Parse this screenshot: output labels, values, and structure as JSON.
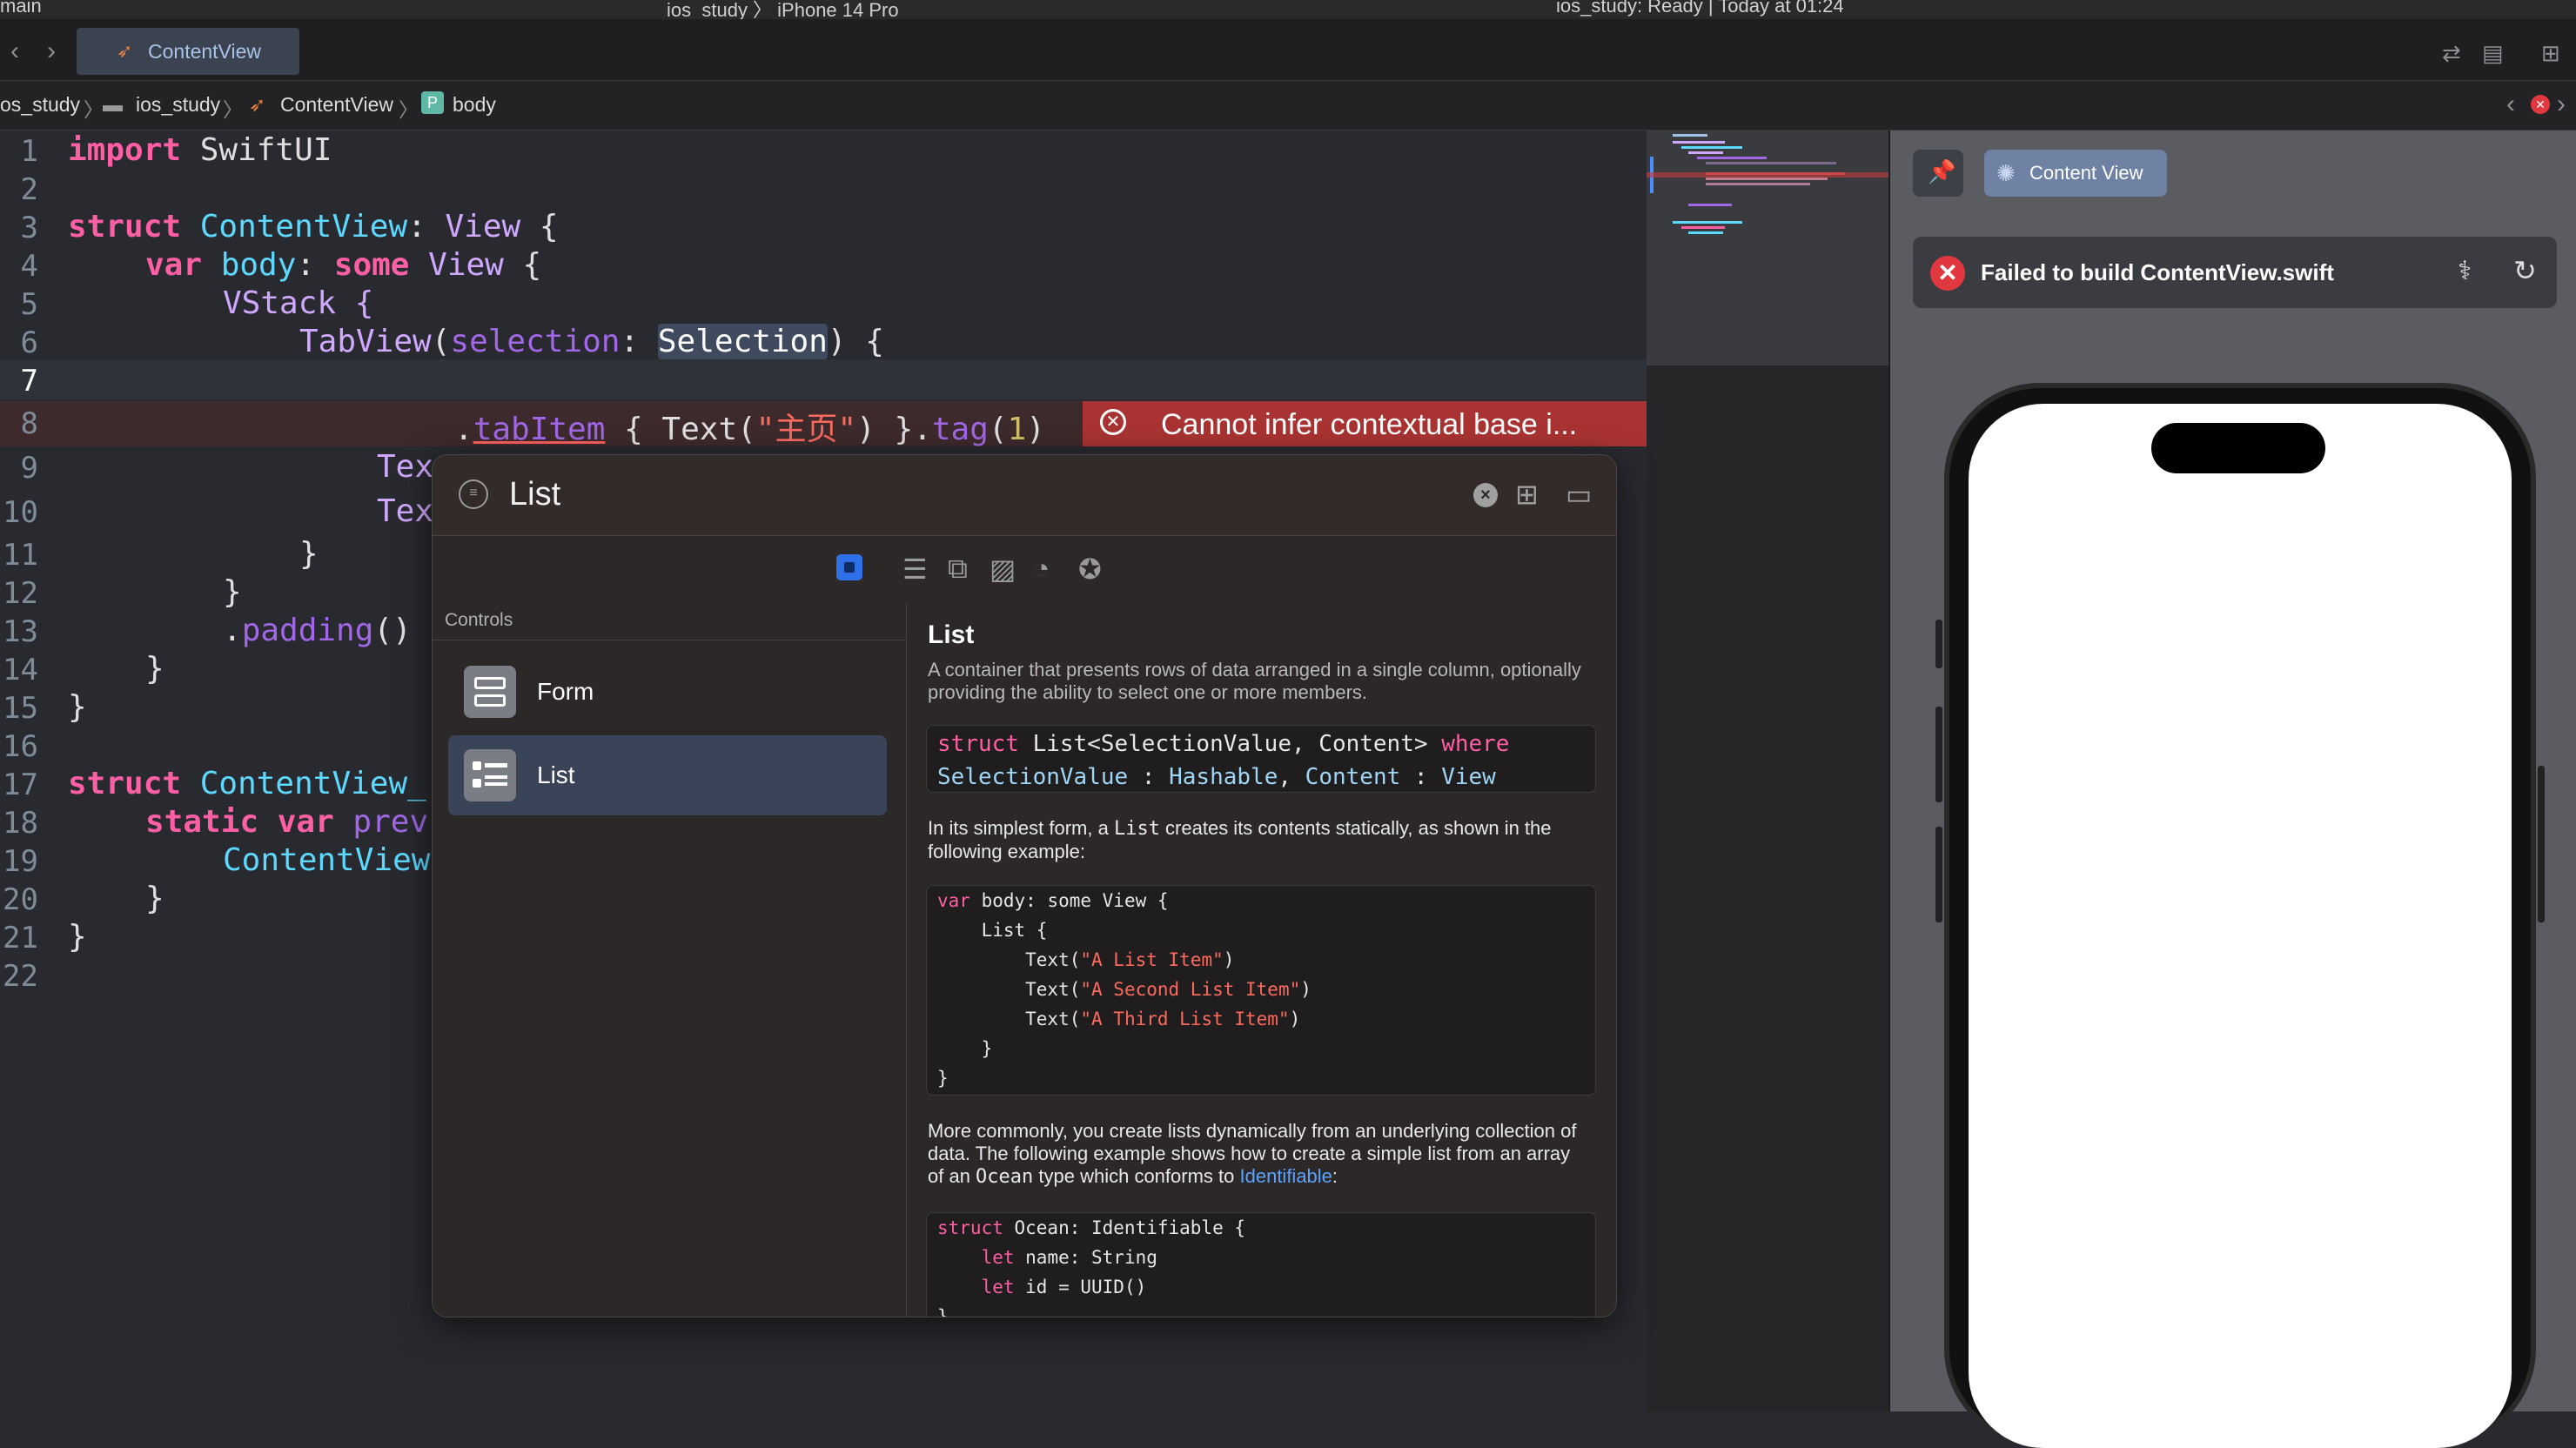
{
  "top": {
    "left_text": "main",
    "device": "ios_study 〉 iPhone 14 Pro",
    "status": "ios_study: Ready | Today at 01:24"
  },
  "tab": {
    "label": "ContentView"
  },
  "breadcrumb": {
    "items": [
      "os_study",
      "ios_study",
      "ContentView",
      "body"
    ],
    "p_badge": "P"
  },
  "editor": {
    "lines": [
      {
        "n": "1"
      },
      {
        "n": "2"
      },
      {
        "n": "3"
      },
      {
        "n": "4"
      },
      {
        "n": "5"
      },
      {
        "n": "6"
      },
      {
        "n": "7"
      },
      {
        "n": "8"
      },
      {
        "n": "9"
      },
      {
        "n": "10"
      },
      {
        "n": "11"
      },
      {
        "n": "12"
      },
      {
        "n": "13"
      },
      {
        "n": "14"
      },
      {
        "n": "15"
      },
      {
        "n": "16"
      },
      {
        "n": "17"
      },
      {
        "n": "18"
      },
      {
        "n": "19"
      },
      {
        "n": "20"
      },
      {
        "n": "21"
      },
      {
        "n": "22"
      }
    ],
    "code": {
      "l1_kw": "import",
      "l1_rest": " SwiftUI",
      "l3_kw": "struct",
      "l3_name": " ContentView",
      "l3_colon": ": ",
      "l3_type": "View",
      "l3_brace": " {",
      "l4_kw": "var",
      "l4_name": " body",
      "l4_colon": ": ",
      "l4_kw2": "some",
      "l4_type": " View",
      "l4_brace": " {",
      "l5": "VStack {",
      "l6_fn": "TabView",
      "l6_p": "(",
      "l6_arg": "selection",
      "l6_colon": ": ",
      "l6_sel": "Selection",
      "l6_end": ") {",
      "l8_dot": ".",
      "l8_fn": "tabItem",
      "l8_a": " { Text(",
      "l8_str": "\"主页\"",
      "l8_b": ") }.",
      "l8_fn2": "tag",
      "l8_c": "(",
      "l8_num": "1",
      "l8_d": ")",
      "l9": "Tex",
      "l10": "Tex",
      "l11": "}",
      "l12": "}",
      "l13_dot": ".",
      "l13_fn": "padding",
      "l13_end": "()",
      "l14": "}",
      "l15": "}",
      "l17_kw": "struct",
      "l17_name": " ContentView_",
      "l18_kw": "static var",
      "l18_rest": " prev",
      "l19": "ContentView",
      "l20": "}",
      "l21": "}"
    },
    "error": "Cannot infer contextual base i..."
  },
  "canvas": {
    "content_view_btn": "Content View",
    "build_error": "Failed to build ContentView.swift"
  },
  "library": {
    "search_value": "List",
    "section": "Controls",
    "items": [
      {
        "label": "Form"
      },
      {
        "label": "List"
      }
    ],
    "detail": {
      "title": "List",
      "summary": "A container that presents rows of data arranged in a single column, optionally providing the ability to select one or more members.",
      "decl_1a": "struct",
      "decl_1b": " List<SelectionValue, Content> ",
      "decl_1c": "where",
      "decl_2a": "SelectionValue",
      "decl_2b": " : ",
      "decl_2c": "Hashable",
      "decl_2d": ", ",
      "decl_2e": "Content",
      "decl_2f": " : ",
      "decl_2g": "View",
      "para1a": "In its simplest form, a ",
      "para1b": "List",
      "para1c": " creates its contents statically, as shown in the following example:",
      "ex1": [
        {
          "k": "var",
          "r": " body: some View {",
          "s": ""
        },
        {
          "k": "",
          "r": "    List {",
          "s": ""
        },
        {
          "k": "",
          "r": "        Text(",
          "s": "\"A List Item\"",
          "e": ")"
        },
        {
          "k": "",
          "r": "        Text(",
          "s": "\"A Second List Item\"",
          "e": ")"
        },
        {
          "k": "",
          "r": "        Text(",
          "s": "\"A Third List Item\"",
          "e": ")"
        },
        {
          "k": "",
          "r": "    }",
          "s": ""
        },
        {
          "k": "",
          "r": "}",
          "s": ""
        }
      ],
      "para2a": "More commonly, you create lists dynamically from an underlying collection of data. The following example shows how to create a simple list from an array of an ",
      "para2b": "Ocean",
      "para2c": " type which conforms to ",
      "para2link": "Identifiable",
      "para2d": ":",
      "ex2": [
        {
          "k": "struct",
          "r": " Ocean: Identifiable {"
        },
        {
          "k": "    let",
          "r": " name: String"
        },
        {
          "k": "    let",
          "r": " id = UUID()"
        },
        {
          "k": "",
          "r": "}"
        }
      ]
    }
  }
}
